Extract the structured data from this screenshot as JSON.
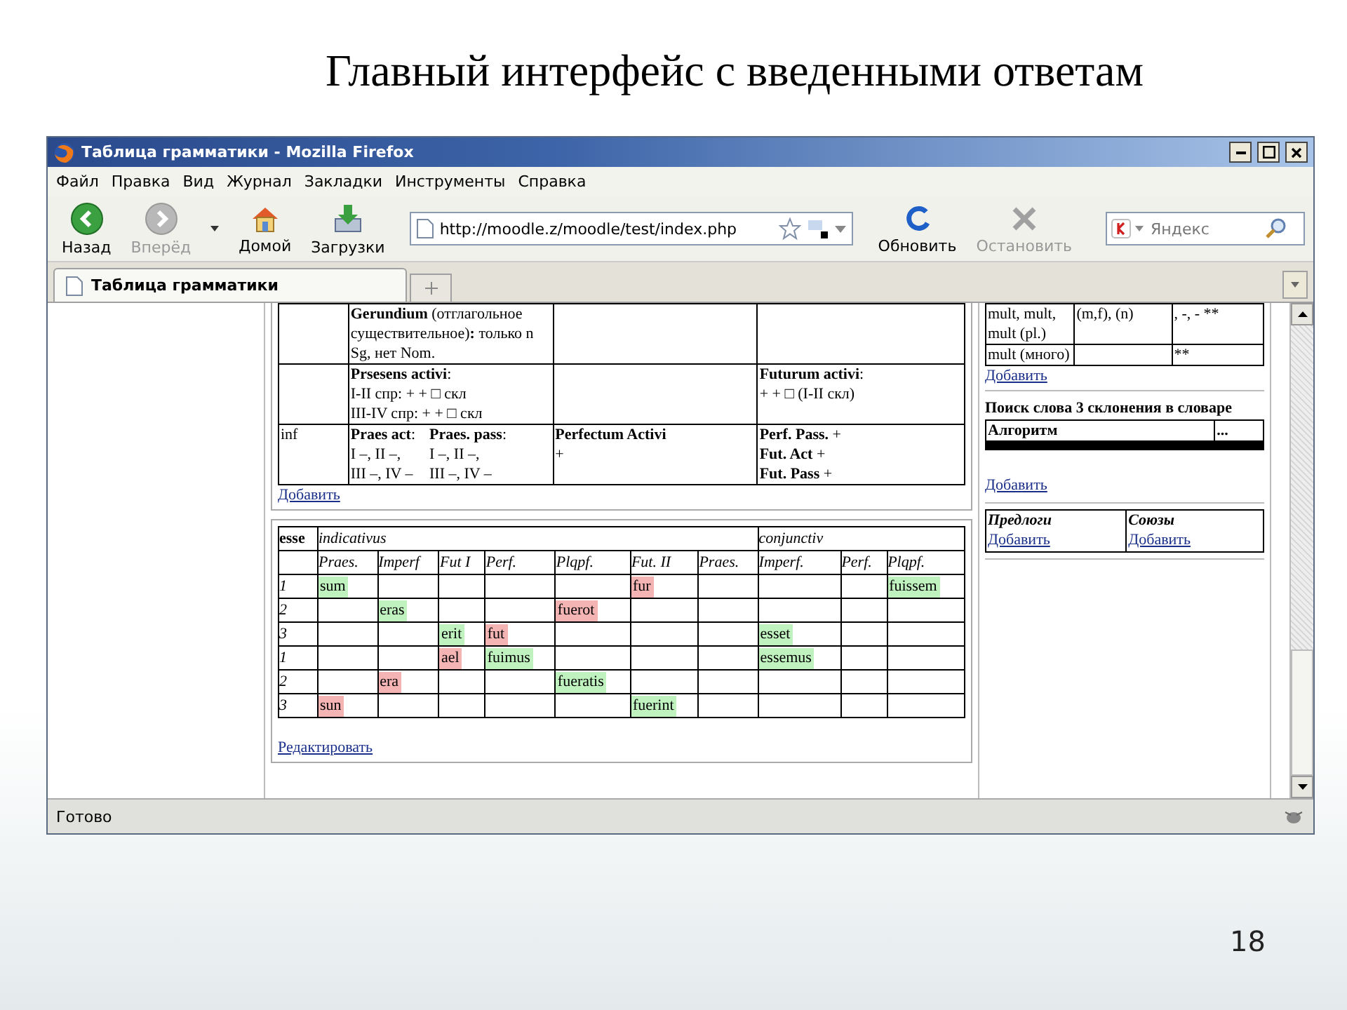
{
  "slide": {
    "title": "Главный интерфейс с введенными ответам",
    "page_number": "18"
  },
  "window": {
    "title": "Таблица грамматики - Mozilla Firefox"
  },
  "menu": [
    "Файл",
    "Правка",
    "Вид",
    "Журнал",
    "Закладки",
    "Инструменты",
    "Справка"
  ],
  "nav_buttons": [
    {
      "kind": "back",
      "label": "Назад",
      "disabled": false
    },
    {
      "kind": "forward",
      "label": "Вперёд",
      "disabled": true
    },
    {
      "kind": "home",
      "label": "Домой",
      "disabled": false
    },
    {
      "kind": "downloads",
      "label": "Загрузки",
      "disabled": false
    }
  ],
  "address": {
    "value": "http://moodle.z/moodle/test/index.php"
  },
  "page_buttons": [
    {
      "kind": "reload",
      "label": "Обновить",
      "disabled": false
    },
    {
      "kind": "stop",
      "label": "Остановить",
      "disabled": true
    }
  ],
  "search": {
    "placeholder": "Яндекс"
  },
  "tabs": [
    {
      "label": "Таблица грамматики",
      "selected": true
    }
  ],
  "grammar_table": {
    "rows": [
      {
        "column_2": [
          [
            "**Gerundium** (отглагольное существительное)**:** только n Sg, нет Nom."
          ]
        ]
      },
      {
        "column_2": [
          [
            "**Prsesens activi**:",
            "I-II спр: + + □ скл",
            "III-IV спр: + + □ скл"
          ]
        ],
        "column_4": [
          [
            "**Futurum activi**:",
            "+ + □ (I-II скл)"
          ]
        ]
      },
      {
        "column_1": [
          [
            "inf"
          ]
        ],
        "column_2": [
          [
            "**Praes act**:",
            "I –, II –,",
            "III –, IV –"
          ],
          [
            "**Praes. pass**:",
            "I –, II –,",
            "III –, IV –"
          ]
        ],
        "column_3": [
          [
            "**Perfectum Activi**",
            "+"
          ]
        ],
        "column_4": [
          [
            "**Perf. Pass.** +",
            "**Fut. Act** +",
            "**Fut. Pass** +"
          ]
        ]
      }
    ],
    "link": "Добавить"
  },
  "conjugation": {
    "verb": "esse",
    "groups": [
      {
        "label": "indicativus",
        "columns": [
          "Praes.",
          "Imperf",
          "Fut I",
          "Perf.",
          "Plqpf.",
          "Fut. II",
          "Praes."
        ]
      },
      {
        "label": "conjunctiv",
        "columns": [
          "Imperf.",
          "Perf.",
          "Plqpf."
        ]
      }
    ],
    "rows": [
      {
        "person": "1",
        "cells": [
          {
            "text": "sum",
            "correct": true
          },
          null,
          null,
          null,
          null,
          {
            "text": "fur",
            "correct": false
          },
          null,
          null,
          null,
          {
            "text": "fuissem",
            "correct": true
          }
        ]
      },
      {
        "person": "2",
        "cells": [
          null,
          {
            "text": "eras",
            "correct": true
          },
          null,
          null,
          {
            "text": "fuerot",
            "correct": false
          },
          null,
          null,
          null,
          null,
          null
        ]
      },
      {
        "person": "3",
        "cells": [
          null,
          null,
          {
            "text": "erit",
            "correct": true
          },
          {
            "text": "fut",
            "correct": false
          },
          null,
          null,
          null,
          {
            "text": "esset",
            "correct": true
          },
          null,
          null
        ]
      },
      {
        "person": "1",
        "cells": [
          null,
          null,
          {
            "text": "ael",
            "correct": false
          },
          {
            "text": "fuimus",
            "correct": true
          },
          null,
          null,
          null,
          {
            "text": "essemus",
            "correct": true
          },
          null,
          null
        ]
      },
      {
        "person": "2",
        "cells": [
          null,
          {
            "text": "era",
            "correct": false
          },
          null,
          null,
          {
            "text": "fueratis",
            "correct": true
          },
          null,
          null,
          null,
          null,
          null
        ]
      },
      {
        "person": "3",
        "cells": [
          {
            "text": "sun",
            "correct": false
          },
          null,
          null,
          null,
          null,
          {
            "text": "fuerint",
            "correct": true
          },
          null,
          null,
          null,
          null
        ]
      }
    ],
    "link": "Редактировать"
  },
  "side": {
    "number_table": [
      {
        "column_1": "mult, mult, mult (pl.)",
        "column_2": "(m,f), (n)",
        "column_3": ", -, - **"
      },
      {
        "column_1": "mult (много)",
        "column_3": "**"
      }
    ],
    "number_link": "Добавить",
    "search_title": "Поиск слова 3 склонения в словаре",
    "search_columns": [
      "Алгоритм",
      "..."
    ],
    "search_link": "Добавить",
    "word_lists": [
      {
        "heading": "Предлоги",
        "link": "Добавить"
      },
      {
        "heading": "Союзы",
        "link": "Добавить"
      }
    ]
  },
  "status_bar": {
    "text": "Готово"
  }
}
